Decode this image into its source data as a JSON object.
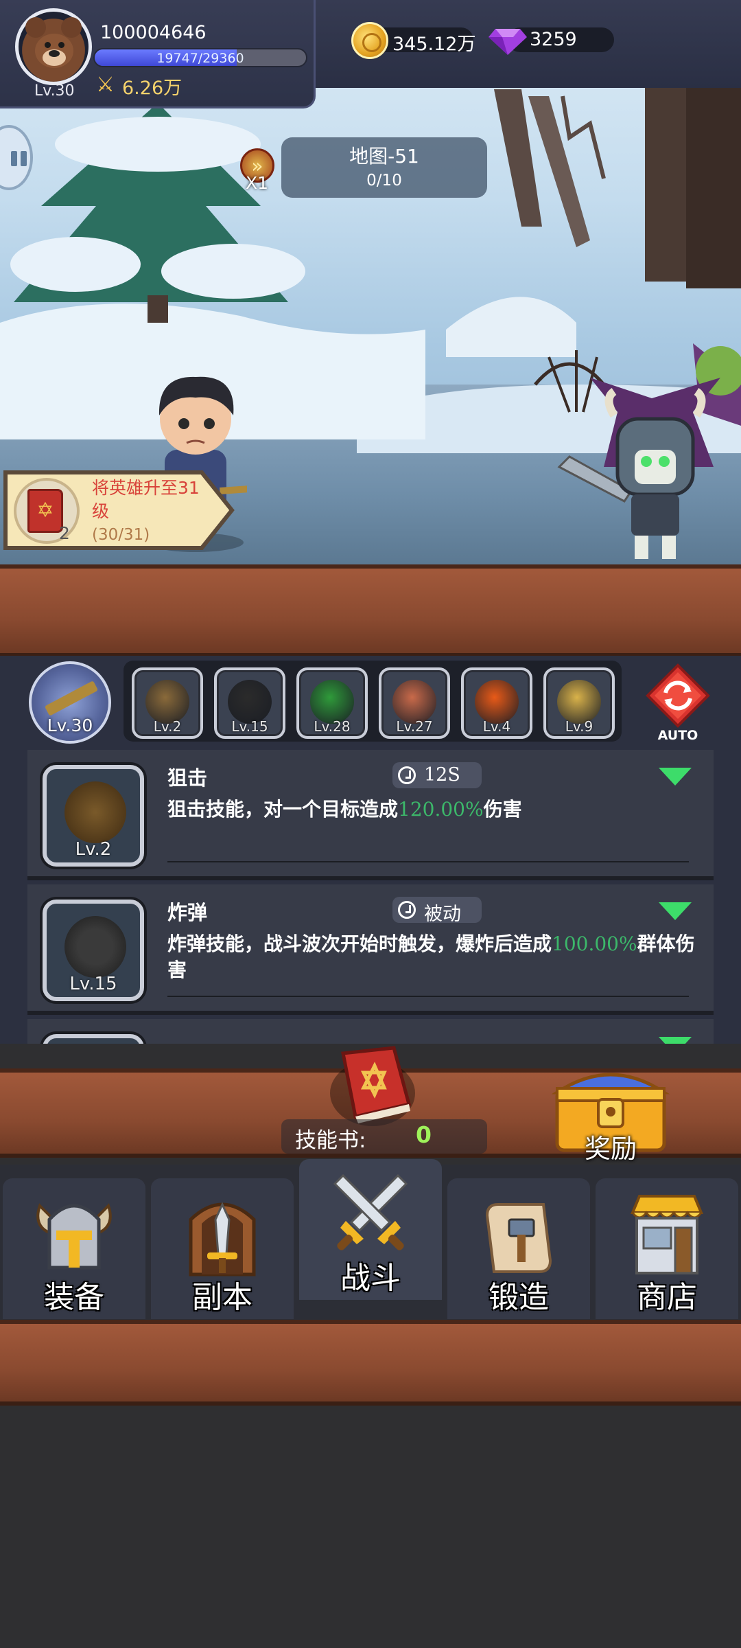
{
  "player": {
    "id": "100004646",
    "level_label": "Lv.30",
    "xp_text": "19747/29360",
    "xp_fraction": 0.6726,
    "power": "6.26万"
  },
  "currency": {
    "gold": "345.12万",
    "gems": "3259"
  },
  "battle": {
    "speed_label": "X1",
    "map_name": "地图-51",
    "wave_progress": "0/10"
  },
  "quest": {
    "title": "将英雄升至31级",
    "progress": "(30/31)",
    "count": "2"
  },
  "weapon": {
    "level_label": "Lv.30"
  },
  "skill_icons": [
    {
      "level": "Lv.2",
      "color": "#8a6a3a"
    },
    {
      "level": "Lv.15",
      "color": "#2b2b2b"
    },
    {
      "level": "Lv.28",
      "color": "#2f9a3a"
    },
    {
      "level": "Lv.27",
      "color": "#c96a4a"
    },
    {
      "level": "Lv.4",
      "color": "#e85a18"
    },
    {
      "level": "Lv.9",
      "color": "#d9b24a"
    }
  ],
  "auto_label": "AUTO",
  "skills": [
    {
      "name": "狙击",
      "cooldown": "12S",
      "desc_prefix": "狙击技能，对一个目标造成",
      "desc_value": "120.00%",
      "desc_suffix": "伤害",
      "level": "Lv.2"
    },
    {
      "name": "炸弹",
      "cooldown": "被动",
      "desc_prefix": "炸弹技能，战斗波次开始时触发，爆炸后造成",
      "desc_value": "100.00%",
      "desc_suffix": "群体伤害",
      "level": "Lv.15"
    }
  ],
  "skill_book": {
    "label": "技能书:",
    "value": "0"
  },
  "reward_label": "奖励",
  "nav": [
    {
      "label": "装备"
    },
    {
      "label": "副本"
    },
    {
      "label": "战斗"
    },
    {
      "label": "锻造"
    },
    {
      "label": "商店"
    }
  ]
}
